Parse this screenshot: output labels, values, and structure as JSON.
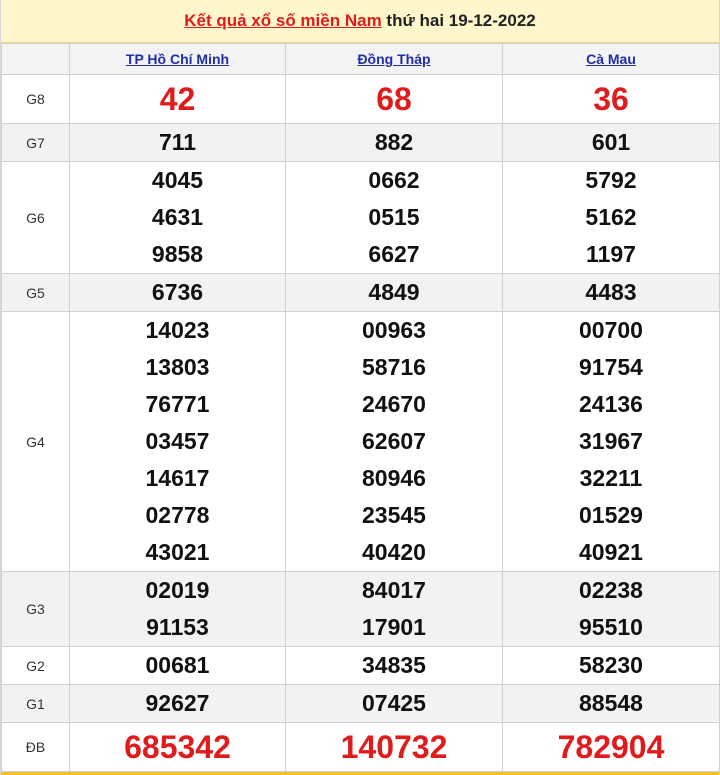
{
  "header": {
    "prefix": "Kết quả xổ số miền Nam",
    "suffix": " thứ hai 19-12-2022"
  },
  "provinces": [
    "TP Hồ Chí Minh",
    "Đồng Tháp",
    "Cà Mau"
  ],
  "prizes": [
    {
      "label": "G8",
      "style": "red-big",
      "values": [
        [
          "42"
        ],
        [
          "68"
        ],
        [
          "36"
        ]
      ]
    },
    {
      "label": "G7",
      "style": "normal",
      "values": [
        [
          "711"
        ],
        [
          "882"
        ],
        [
          "601"
        ]
      ]
    },
    {
      "label": "G6",
      "style": "normal",
      "values": [
        [
          "4045",
          "4631",
          "9858"
        ],
        [
          "0662",
          "0515",
          "6627"
        ],
        [
          "5792",
          "5162",
          "1197"
        ]
      ]
    },
    {
      "label": "G5",
      "style": "normal",
      "values": [
        [
          "6736"
        ],
        [
          "4849"
        ],
        [
          "4483"
        ]
      ]
    },
    {
      "label": "G4",
      "style": "normal",
      "values": [
        [
          "14023",
          "13803",
          "76771",
          "03457",
          "14617",
          "02778",
          "43021"
        ],
        [
          "00963",
          "58716",
          "24670",
          "62607",
          "80946",
          "23545",
          "40420"
        ],
        [
          "00700",
          "91754",
          "24136",
          "31967",
          "32211",
          "01529",
          "40921"
        ]
      ]
    },
    {
      "label": "G3",
      "style": "normal",
      "values": [
        [
          "02019",
          "91153"
        ],
        [
          "84017",
          "17901"
        ],
        [
          "02238",
          "95510"
        ]
      ]
    },
    {
      "label": "G2",
      "style": "normal",
      "values": [
        [
          "00681"
        ],
        [
          "34835"
        ],
        [
          "58230"
        ]
      ]
    },
    {
      "label": "G1",
      "style": "normal",
      "values": [
        [
          "92627"
        ],
        [
          "07425"
        ],
        [
          "88548"
        ]
      ]
    },
    {
      "label": "ĐB",
      "style": "red-big",
      "values": [
        [
          "685342"
        ],
        [
          "140732"
        ],
        [
          "782904"
        ]
      ]
    }
  ]
}
